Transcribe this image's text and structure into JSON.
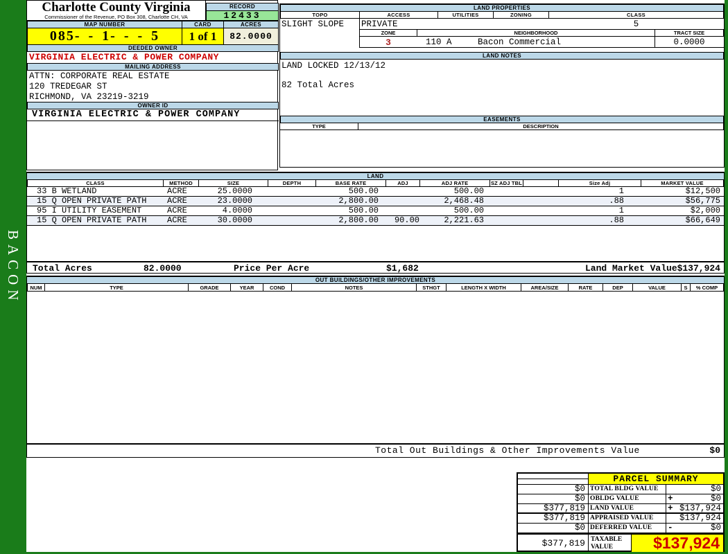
{
  "colors": {
    "frame_green": "#1a7c1a",
    "section_header_blue": "#bcd8e8",
    "highlight_yellow": "#ffff00",
    "record_green": "#98e698",
    "acres_beige": "#f0efdc",
    "alert_red": "#cc0000"
  },
  "sidebar": {
    "vertical_label": "BACON"
  },
  "header": {
    "county": "Charlotte County Virginia",
    "commissioner": "Commissioner of the Revenue, PO Box 308, Charlotte CH, VA",
    "record_label": "RECORD",
    "record_value": "12433",
    "map_number_label": "MAP NUMBER",
    "map_number_value": "085- - 1- - - 5",
    "card_label": "CARD",
    "card_value": "1 of 1",
    "acres_label": "ACRES",
    "acres_value": "82.0000"
  },
  "owner": {
    "deeded_owner_label": "DEEDED OWNER",
    "deeded_owner": "VIRGINIA ELECTRIC & POWER COMPANY",
    "mailing_address_label": "MAILING ADDRESS",
    "address_lines": [
      "ATTN: CORPORATE REAL ESTATE",
      "120 TREDEGAR ST",
      "RICHMOND, VA 23219-3219"
    ],
    "owner_id_label": "OWNER ID",
    "owner_id": "VIRGINIA ELECTRIC & POWER COMPANY"
  },
  "land_properties": {
    "section_label": "LAND PROPERTIES",
    "topo_label": "TOPO",
    "topo": "SLIGHT SLOPE",
    "access_label": "ACCESS",
    "access": "PRIVATE",
    "utilities_label": "UTILITIES",
    "utilities": "",
    "zoning_label": "ZONING",
    "zoning": "",
    "class_label": "CLASS",
    "class": "5",
    "zone_label": "ZONE",
    "zone": "3",
    "neighborhood_label": "NEIGHBORHOOD",
    "neighborhood_code": "110 A",
    "neighborhood_name": "Bacon Commercial",
    "tract_size_label": "TRACT SIZE",
    "tract_size": "0.0000"
  },
  "land_notes": {
    "section_label": "LAND NOTES",
    "lines": [
      "LAND LOCKED 12/13/12",
      "",
      "82 Total Acres"
    ]
  },
  "easements": {
    "section_label": "EASEMENTS",
    "type_label": "TYPE",
    "description_label": "DESCRIPTION"
  },
  "land": {
    "section_label": "LAND",
    "headers": [
      "CLASS",
      "METHOD",
      "SIZE",
      "DEPTH",
      "BASE RATE",
      "ADJ",
      "ADJ RATE",
      "SZ ADJ TBL",
      "",
      "Size Adj",
      "MARKET VALUE"
    ],
    "rows": [
      {
        "class": "33 B WETLAND",
        "method": "ACRE",
        "size": "25.0000",
        "depth": "",
        "base_rate": "500.00",
        "adj": "",
        "adj_rate": "500.00",
        "sz_adj_tbl": "",
        "size_adj": "1",
        "market_value": "$12,500"
      },
      {
        "class": "15 Q OPEN PRIVATE PATH",
        "method": "ACRE",
        "size": "23.0000",
        "depth": "",
        "base_rate": "2,800.00",
        "adj": "",
        "adj_rate": "2,468.48",
        "sz_adj_tbl": "",
        "size_adj": ".88",
        "market_value": "$56,775"
      },
      {
        "class": "95 I UTILITY EASEMENT",
        "method": "ACRE",
        "size": "4.0000",
        "depth": "",
        "base_rate": "500.00",
        "adj": "",
        "adj_rate": "500.00",
        "sz_adj_tbl": "",
        "size_adj": "1",
        "market_value": "$2,000"
      },
      {
        "class": "15 Q OPEN PRIVATE PATH",
        "method": "ACRE",
        "size": "30.0000",
        "depth": "",
        "base_rate": "2,800.00",
        "adj": "90.00",
        "adj_rate": "2,221.63",
        "sz_adj_tbl": "",
        "size_adj": ".88",
        "market_value": "$66,649"
      }
    ],
    "totals": {
      "total_acres_label": "Total Acres",
      "total_acres": "82.0000",
      "price_per_acre_label": "Price Per Acre",
      "price_per_acre": "$1,682",
      "land_market_value_label": "Land Market Value",
      "land_market_value": "$137,924"
    }
  },
  "out_buildings": {
    "section_label": "OUT BUILDINGS/OTHER IMPROVEMENTS",
    "headers": [
      "NUM",
      "TYPE",
      "GRADE",
      "YEAR",
      "COND",
      "NOTES",
      "STHGT",
      "LENGTH X WIDTH",
      "AREA/SIZE",
      "RATE",
      "DEP",
      "VALUE",
      "S",
      "% COMP"
    ],
    "total_label": "Total Out Buildings & Other Improvements Value",
    "total_value": "$0"
  },
  "parcel_summary": {
    "title": "PARCEL SUMMARY",
    "rows": [
      {
        "left": "$0",
        "label": "TOTAL BLDG VALUE",
        "sign": "",
        "right": "$0"
      },
      {
        "left": "$0",
        "label": "OBLDG VALUE",
        "sign": "+",
        "right": "$0"
      },
      {
        "left": "$377,819",
        "label": "LAND VALUE",
        "sign": "+",
        "right": "$137,924"
      },
      {
        "left": "$377,819",
        "label": "APPRAISED VALUE",
        "sign": "",
        "right": "$137,924"
      },
      {
        "left": "$0",
        "label": "DEFERRED VALUE",
        "sign": "-",
        "right": "$0"
      }
    ],
    "taxable": {
      "left": "$377,819",
      "label": "TAXABLE VALUE",
      "value": "$137,924"
    }
  }
}
